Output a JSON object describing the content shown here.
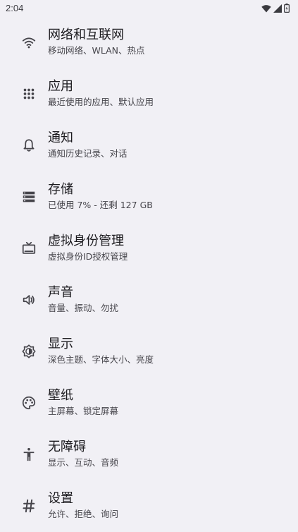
{
  "status": {
    "time": "2:04",
    "icons": [
      "wifi-icon",
      "signal-icon",
      "battery-icon"
    ]
  },
  "settings": [
    {
      "icon": "wifi-icon",
      "title": "网络和互联网",
      "summary": "移动网络、WLAN、热点"
    },
    {
      "icon": "apps-grid-icon",
      "title": "应用",
      "summary": "最近使用的应用、默认应用"
    },
    {
      "icon": "bell-icon",
      "title": "通知",
      "summary": "通知历史记录、对话"
    },
    {
      "icon": "storage-icon",
      "title": "存储",
      "summary": "已使用 7% - 还剩 127 GB"
    },
    {
      "icon": "tv-icon",
      "title": "虚拟身份管理",
      "summary": "虚拟身份ID授权管理"
    },
    {
      "icon": "speaker-icon",
      "title": "声音",
      "summary": "音量、振动、勿扰"
    },
    {
      "icon": "brightness-icon",
      "title": "显示",
      "summary": "深色主题、字体大小、亮度"
    },
    {
      "icon": "palette-icon",
      "title": "壁纸",
      "summary": "主屏幕、锁定屏幕"
    },
    {
      "icon": "accessibility-icon",
      "title": "无障碍",
      "summary": "显示、互动、音频"
    },
    {
      "icon": "hash-icon",
      "title": "设置",
      "summary": "允许、拒绝、询问"
    }
  ]
}
